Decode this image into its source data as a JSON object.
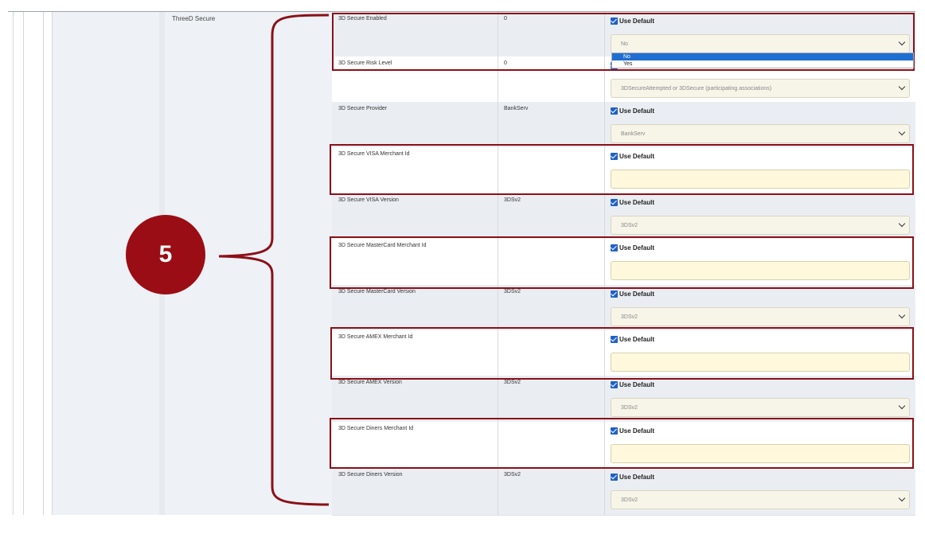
{
  "group_label": "ThreeD Secure",
  "use_default_label": "Use Default",
  "callout_number": "5",
  "dropdown": {
    "options": [
      "No",
      "Yes"
    ],
    "selected": "No"
  },
  "rows": [
    {
      "name": "3D Secure Enabled",
      "value": "0",
      "field_type": "select",
      "field_value": "No"
    },
    {
      "name": "3D Secure Risk Level",
      "value": "0",
      "field_type": "select",
      "field_value": "3DSecureAttempted or 3DSecure (participating associations)"
    },
    {
      "name": "3D Secure Provider",
      "value": "BankServ",
      "field_type": "select",
      "field_value": "BankServ"
    },
    {
      "name": "3D Secure VISA Merchant Id",
      "value": "",
      "field_type": "input",
      "field_value": ""
    },
    {
      "name": "3D Secure VISA Version",
      "value": "3DSv2",
      "field_type": "select",
      "field_value": "3DSv2"
    },
    {
      "name": "3D Secure MasterCard Merchant Id",
      "value": "",
      "field_type": "input",
      "field_value": ""
    },
    {
      "name": "3D Secure MasterCard Version",
      "value": "3DSv2",
      "field_type": "select",
      "field_value": "3DSv2"
    },
    {
      "name": "3D Secure AMEX Merchant Id",
      "value": "",
      "field_type": "input",
      "field_value": ""
    },
    {
      "name": "3D Secure AMEX Version",
      "value": "3DSv2",
      "field_type": "select",
      "field_value": "3DSv2"
    },
    {
      "name": "3D Secure Diners Merchant Id",
      "value": "",
      "field_type": "input",
      "field_value": ""
    },
    {
      "name": "3D Secure Diners Version",
      "value": "3DSv2",
      "field_type": "select",
      "field_value": "3DSv2"
    }
  ],
  "colors": {
    "highlight": "#8b1018",
    "badge": "#9b0d14",
    "checkbox": "#2060c8"
  }
}
